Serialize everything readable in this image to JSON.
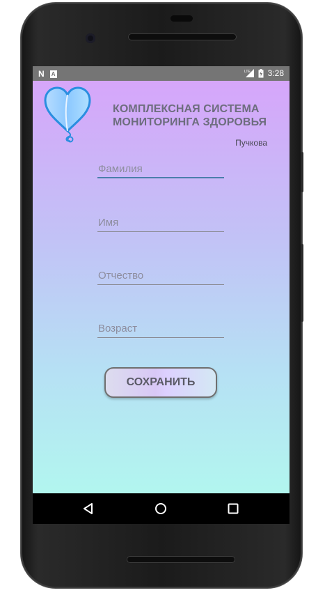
{
  "statusbar": {
    "left_icons": [
      "n-notification-icon",
      "a-notification-icon"
    ],
    "network": "LTE",
    "time": "3:28"
  },
  "app": {
    "title_line1": "КОМПЛЕКСНАЯ СИСТЕМА",
    "title_line2": "МОНИТОРИНГА ЗДОРОВЬЯ",
    "author": "Пучкова",
    "logo_icon": "heart-balloon-icon"
  },
  "form": {
    "surname": {
      "placeholder": "Фамилия",
      "value": ""
    },
    "name": {
      "placeholder": "Имя",
      "value": ""
    },
    "patronymic": {
      "placeholder": "Отчество",
      "value": ""
    },
    "age": {
      "placeholder": "Возраст",
      "value": ""
    },
    "save_label": "СОХРАНИТЬ"
  },
  "navbar": {
    "back_icon": "back-triangle-icon",
    "home_icon": "home-circle-icon",
    "recents_icon": "recents-square-icon"
  },
  "colors": {
    "gradient_top": "#d6a6fa",
    "gradient_bottom": "#b2f6ef",
    "focus_line": "#4a7eab",
    "title_text": "#6d6d7e",
    "logo_stroke": "#2a8ee0"
  }
}
